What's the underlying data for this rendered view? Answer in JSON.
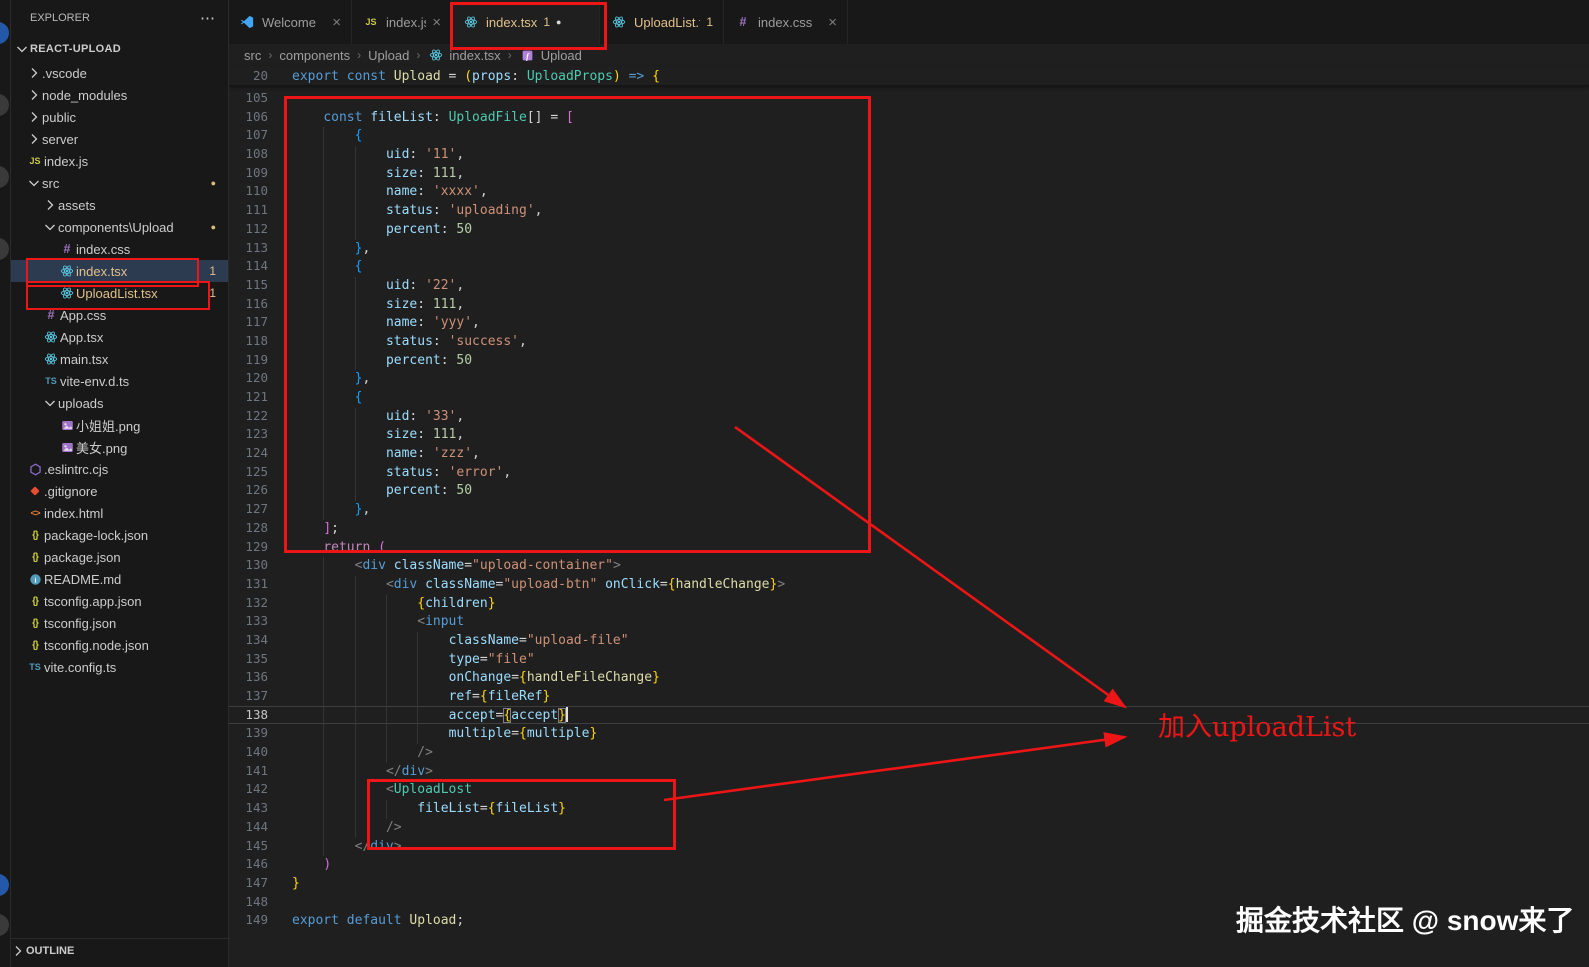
{
  "explorer": {
    "title": "EXPLORER",
    "more_icon": "⋯",
    "project": "REACT-UPLOAD",
    "outline_label": "OUTLINE",
    "tree": [
      {
        "label": ".vscode",
        "indent": 0,
        "chevron": "closed"
      },
      {
        "label": "node_modules",
        "indent": 0,
        "chevron": "closed"
      },
      {
        "label": "public",
        "indent": 0,
        "chevron": "closed"
      },
      {
        "label": "server",
        "indent": 0,
        "chevron": "closed"
      },
      {
        "label": "index.js",
        "indent": 0,
        "icon": "js"
      },
      {
        "label": "src",
        "indent": 0,
        "chevron": "open",
        "dot": true
      },
      {
        "label": "assets",
        "indent": 1,
        "chevron": "closed"
      },
      {
        "label": "components\\Upload",
        "indent": 1,
        "chevron": "open",
        "dot": true
      },
      {
        "label": "index.css",
        "indent": 2,
        "icon": "css"
      },
      {
        "label": "index.tsx",
        "indent": 2,
        "icon": "react",
        "badge": "1",
        "selected": true,
        "warn": true
      },
      {
        "label": "UploadList.tsx",
        "indent": 2,
        "icon": "react",
        "badge": "1",
        "warn": true
      },
      {
        "label": "App.css",
        "indent": 1,
        "icon": "css"
      },
      {
        "label": "App.tsx",
        "indent": 1,
        "icon": "react"
      },
      {
        "label": "main.tsx",
        "indent": 1,
        "icon": "react"
      },
      {
        "label": "vite-env.d.ts",
        "indent": 1,
        "icon": "ts"
      },
      {
        "label": "uploads",
        "indent": 1,
        "chevron": "open"
      },
      {
        "label": "小姐姐.png",
        "indent": 2,
        "icon": "img"
      },
      {
        "label": "美女.png",
        "indent": 2,
        "icon": "img"
      },
      {
        "label": ".eslintrc.cjs",
        "indent": 0,
        "icon": "eslint"
      },
      {
        "label": ".gitignore",
        "indent": 0,
        "icon": "git"
      },
      {
        "label": "index.html",
        "indent": 0,
        "icon": "html"
      },
      {
        "label": "package-lock.json",
        "indent": 0,
        "icon": "json"
      },
      {
        "label": "package.json",
        "indent": 0,
        "icon": "json"
      },
      {
        "label": "README.md",
        "indent": 0,
        "icon": "info"
      },
      {
        "label": "tsconfig.app.json",
        "indent": 0,
        "icon": "json"
      },
      {
        "label": "tsconfig.json",
        "indent": 0,
        "icon": "json"
      },
      {
        "label": "tsconfig.node.json",
        "indent": 0,
        "icon": "json"
      },
      {
        "label": "vite.config.ts",
        "indent": 0,
        "icon": "ts"
      }
    ]
  },
  "tabs": [
    {
      "label": "Welcome",
      "icon": "welcome",
      "close": true
    },
    {
      "label": "index.js",
      "icon": "js",
      "close": true
    },
    {
      "label": "index.tsx",
      "icon": "react",
      "badge": "1",
      "dirty": true,
      "active": true,
      "warn": true
    },
    {
      "label": "UploadList.tsx",
      "icon": "react",
      "badge": "1",
      "warn": true
    },
    {
      "label": "index.css",
      "icon": "css",
      "close": true
    }
  ],
  "breadcrumbs": [
    {
      "label": "src"
    },
    {
      "label": "components"
    },
    {
      "label": "Upload"
    },
    {
      "label": "index.tsx",
      "icon": "react"
    },
    {
      "label": "Upload",
      "icon": "symbol"
    }
  ],
  "editor": {
    "active_line": 138,
    "sticky": {
      "n": 20,
      "i": 0,
      "t": [
        [
          "export ",
          "kw"
        ],
        [
          "const ",
          "kw"
        ],
        [
          "Upload",
          "fn"
        ],
        [
          " = ",
          "pun"
        ],
        [
          "(",
          "b1"
        ],
        [
          "props",
          "var"
        ],
        [
          ": ",
          "pun"
        ],
        [
          "UploadProps",
          "type"
        ],
        [
          ")",
          "b1"
        ],
        [
          " ",
          "pun"
        ],
        [
          "=>",
          "kw"
        ],
        [
          " ",
          "pun"
        ],
        [
          "{",
          "b1"
        ]
      ]
    },
    "lines": [
      {
        "n": 105,
        "i": 0,
        "t": []
      },
      {
        "n": 106,
        "i": 1,
        "t": [
          [
            "const ",
            "kw"
          ],
          [
            "fileList",
            "var"
          ],
          [
            ": ",
            "pun"
          ],
          [
            "UploadFile",
            "type"
          ],
          [
            "[]",
            "pun"
          ],
          [
            " = ",
            "pun"
          ],
          [
            "[",
            "b2"
          ]
        ]
      },
      {
        "n": 107,
        "i": 2,
        "t": [
          [
            "{",
            "b3"
          ]
        ]
      },
      {
        "n": 108,
        "i": 3,
        "t": [
          [
            "uid",
            "var"
          ],
          [
            ": ",
            "pun"
          ],
          [
            "'11'",
            "str"
          ],
          [
            ",",
            "pun"
          ]
        ]
      },
      {
        "n": 109,
        "i": 3,
        "t": [
          [
            "size",
            "var"
          ],
          [
            ": ",
            "pun"
          ],
          [
            "111",
            "num"
          ],
          [
            ",",
            "pun"
          ]
        ]
      },
      {
        "n": 110,
        "i": 3,
        "t": [
          [
            "name",
            "var"
          ],
          [
            ": ",
            "pun"
          ],
          [
            "'xxxx'",
            "str"
          ],
          [
            ",",
            "pun"
          ]
        ]
      },
      {
        "n": 111,
        "i": 3,
        "t": [
          [
            "status",
            "var"
          ],
          [
            ": ",
            "pun"
          ],
          [
            "'uploading'",
            "str"
          ],
          [
            ",",
            "pun"
          ]
        ]
      },
      {
        "n": 112,
        "i": 3,
        "t": [
          [
            "percent",
            "var"
          ],
          [
            ": ",
            "pun"
          ],
          [
            "50",
            "num"
          ]
        ]
      },
      {
        "n": 113,
        "i": 2,
        "t": [
          [
            "}",
            "b3"
          ],
          [
            ",",
            "pun"
          ]
        ]
      },
      {
        "n": 114,
        "i": 2,
        "t": [
          [
            "{",
            "b3"
          ]
        ]
      },
      {
        "n": 115,
        "i": 3,
        "t": [
          [
            "uid",
            "var"
          ],
          [
            ": ",
            "pun"
          ],
          [
            "'22'",
            "str"
          ],
          [
            ",",
            "pun"
          ]
        ]
      },
      {
        "n": 116,
        "i": 3,
        "t": [
          [
            "size",
            "var"
          ],
          [
            ": ",
            "pun"
          ],
          [
            "111",
            "num"
          ],
          [
            ",",
            "pun"
          ]
        ]
      },
      {
        "n": 117,
        "i": 3,
        "t": [
          [
            "name",
            "var"
          ],
          [
            ": ",
            "pun"
          ],
          [
            "'yyy'",
            "str"
          ],
          [
            ",",
            "pun"
          ]
        ]
      },
      {
        "n": 118,
        "i": 3,
        "t": [
          [
            "status",
            "var"
          ],
          [
            ": ",
            "pun"
          ],
          [
            "'success'",
            "str"
          ],
          [
            ",",
            "pun"
          ]
        ]
      },
      {
        "n": 119,
        "i": 3,
        "t": [
          [
            "percent",
            "var"
          ],
          [
            ": ",
            "pun"
          ],
          [
            "50",
            "num"
          ]
        ]
      },
      {
        "n": 120,
        "i": 2,
        "t": [
          [
            "}",
            "b3"
          ],
          [
            ",",
            "pun"
          ]
        ]
      },
      {
        "n": 121,
        "i": 2,
        "t": [
          [
            "{",
            "b3"
          ]
        ]
      },
      {
        "n": 122,
        "i": 3,
        "t": [
          [
            "uid",
            "var"
          ],
          [
            ": ",
            "pun"
          ],
          [
            "'33'",
            "str"
          ],
          [
            ",",
            "pun"
          ]
        ]
      },
      {
        "n": 123,
        "i": 3,
        "t": [
          [
            "size",
            "var"
          ],
          [
            ": ",
            "pun"
          ],
          [
            "111",
            "num"
          ],
          [
            ",",
            "pun"
          ]
        ]
      },
      {
        "n": 124,
        "i": 3,
        "t": [
          [
            "name",
            "var"
          ],
          [
            ": ",
            "pun"
          ],
          [
            "'zzz'",
            "str"
          ],
          [
            ",",
            "pun"
          ]
        ]
      },
      {
        "n": 125,
        "i": 3,
        "t": [
          [
            "status",
            "var"
          ],
          [
            ": ",
            "pun"
          ],
          [
            "'error'",
            "str"
          ],
          [
            ",",
            "pun"
          ]
        ]
      },
      {
        "n": 126,
        "i": 3,
        "t": [
          [
            "percent",
            "var"
          ],
          [
            ": ",
            "pun"
          ],
          [
            "50",
            "num"
          ]
        ]
      },
      {
        "n": 127,
        "i": 2,
        "t": [
          [
            "}",
            "b3"
          ],
          [
            ",",
            "pun"
          ]
        ]
      },
      {
        "n": 128,
        "i": 1,
        "t": [
          [
            "]",
            "b2"
          ],
          [
            ";",
            "pun"
          ]
        ]
      },
      {
        "n": 129,
        "i": 1,
        "t": [
          [
            "return",
            "ctl"
          ],
          [
            " ",
            "pun"
          ],
          [
            "(",
            "b2"
          ]
        ]
      },
      {
        "n": 130,
        "i": 2,
        "t": [
          [
            "<",
            "ab"
          ],
          [
            "div",
            "tag"
          ],
          [
            " ",
            "pun"
          ],
          [
            "className",
            "attr"
          ],
          [
            "=",
            "pun"
          ],
          [
            "\"upload-container\"",
            "str"
          ],
          [
            ">",
            "ab"
          ]
        ]
      },
      {
        "n": 131,
        "i": 3,
        "t": [
          [
            "<",
            "ab"
          ],
          [
            "div",
            "tag"
          ],
          [
            " ",
            "pun"
          ],
          [
            "className",
            "attr"
          ],
          [
            "=",
            "pun"
          ],
          [
            "\"upload-btn\"",
            "str"
          ],
          [
            " ",
            "pun"
          ],
          [
            "onClick",
            "attr"
          ],
          [
            "=",
            "pun"
          ],
          [
            "{",
            "b1"
          ],
          [
            "handleChange",
            "fn"
          ],
          [
            "}",
            "b1"
          ],
          [
            ">",
            "ab"
          ]
        ]
      },
      {
        "n": 132,
        "i": 4,
        "t": [
          [
            "{",
            "b1"
          ],
          [
            "children",
            "var"
          ],
          [
            "}",
            "b1"
          ]
        ]
      },
      {
        "n": 133,
        "i": 4,
        "t": [
          [
            "<",
            "ab"
          ],
          [
            "input",
            "tag"
          ]
        ]
      },
      {
        "n": 134,
        "i": 5,
        "t": [
          [
            "className",
            "attr"
          ],
          [
            "=",
            "pun"
          ],
          [
            "\"upload-file\"",
            "str"
          ]
        ]
      },
      {
        "n": 135,
        "i": 5,
        "t": [
          [
            "type",
            "attr"
          ],
          [
            "=",
            "pun"
          ],
          [
            "\"file\"",
            "str"
          ]
        ]
      },
      {
        "n": 136,
        "i": 5,
        "t": [
          [
            "onChange",
            "attr"
          ],
          [
            "=",
            "pun"
          ],
          [
            "{",
            "b1"
          ],
          [
            "handleFileChange",
            "fn"
          ],
          [
            "}",
            "b1"
          ]
        ]
      },
      {
        "n": 137,
        "i": 5,
        "t": [
          [
            "ref",
            "attr"
          ],
          [
            "=",
            "pun"
          ],
          [
            "{",
            "b1"
          ],
          [
            "fileRef",
            "var"
          ],
          [
            "}",
            "b1"
          ]
        ]
      },
      {
        "n": 138,
        "i": 5,
        "t": [
          [
            "accept",
            "attr"
          ],
          [
            "=",
            "pun"
          ],
          [
            "{",
            "b1h"
          ],
          [
            "accept",
            "var"
          ],
          [
            "}",
            "b1h"
          ],
          [
            "",
            "cursor"
          ]
        ]
      },
      {
        "n": 139,
        "i": 5,
        "t": [
          [
            "multiple",
            "attr"
          ],
          [
            "=",
            "pun"
          ],
          [
            "{",
            "b1"
          ],
          [
            "multiple",
            "var"
          ],
          [
            "}",
            "b1"
          ]
        ]
      },
      {
        "n": 140,
        "i": 4,
        "t": [
          [
            "/>",
            "ab"
          ]
        ]
      },
      {
        "n": 141,
        "i": 3,
        "t": [
          [
            "</",
            "ab"
          ],
          [
            "div",
            "tag"
          ],
          [
            ">",
            "ab"
          ]
        ]
      },
      {
        "n": 142,
        "i": 3,
        "t": [
          [
            "<",
            "ab"
          ],
          [
            "UploadLost",
            "comp"
          ]
        ]
      },
      {
        "n": 143,
        "i": 4,
        "t": [
          [
            "fileList",
            "attr"
          ],
          [
            "=",
            "pun"
          ],
          [
            "{",
            "b1"
          ],
          [
            "fileList",
            "var"
          ],
          [
            "}",
            "b1"
          ]
        ]
      },
      {
        "n": 144,
        "i": 3,
        "t": [
          [
            "/>",
            "ab"
          ]
        ]
      },
      {
        "n": 145,
        "i": 2,
        "t": [
          [
            "</",
            "ab"
          ],
          [
            "div",
            "tag"
          ],
          [
            ">",
            "ab"
          ]
        ]
      },
      {
        "n": 146,
        "i": 1,
        "t": [
          [
            ")",
            "b2"
          ]
        ]
      },
      {
        "n": 147,
        "i": 0,
        "t": [
          [
            "}",
            "b1"
          ]
        ]
      },
      {
        "n": 148,
        "i": 0,
        "t": []
      },
      {
        "n": 149,
        "i": 0,
        "t": [
          [
            "export ",
            "kw"
          ],
          [
            "default ",
            "kw"
          ],
          [
            "Upload",
            "fn"
          ],
          [
            ";",
            "pun"
          ]
        ]
      }
    ]
  },
  "annotations": {
    "color": "#ed1515",
    "arrow_label": "加入uploadList"
  },
  "colors": {
    "modified_yellow": "#e2c08d",
    "editor_bg": "#1f1f1f",
    "sidebar_bg": "#181818"
  },
  "watermark": "掘金技术社区 @ snow来了"
}
